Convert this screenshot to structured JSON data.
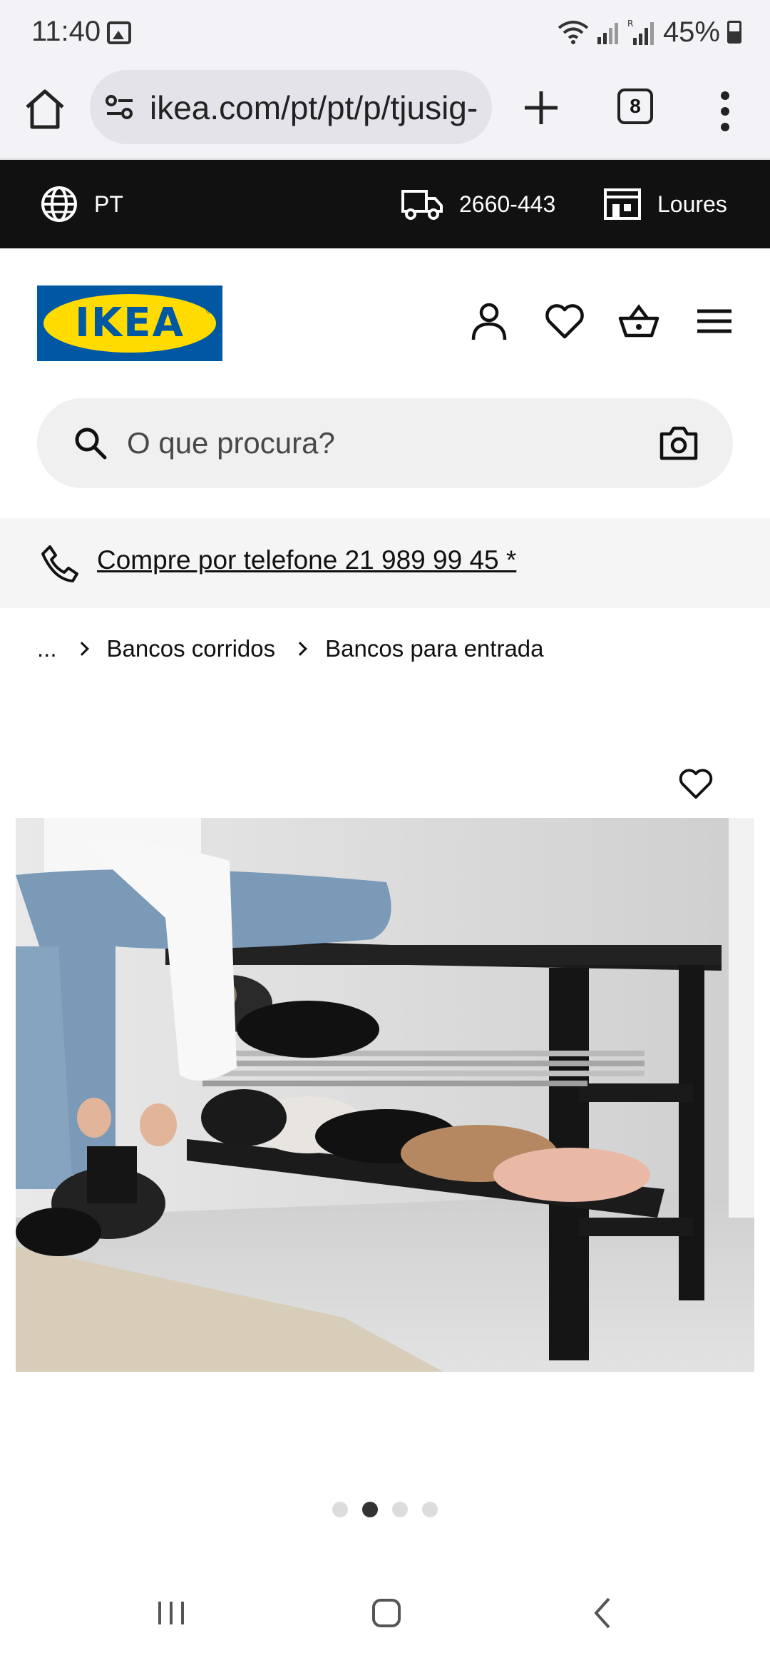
{
  "status_bar": {
    "time": "11:40",
    "battery": "45%"
  },
  "browser": {
    "url": "ikea.com/pt/pt/p/tjusig-",
    "tab_count": "8"
  },
  "top_strip": {
    "language": "PT",
    "postal_code": "2660-443",
    "store": "Loures"
  },
  "header": {
    "logo_text": "IKEA",
    "search_placeholder": "O que procura?"
  },
  "phone_banner": {
    "text": "Compre por telefone 21 989 99 45 *"
  },
  "breadcrumb": {
    "ellipsis": "...",
    "items": [
      "Bancos corridos",
      "Bancos para entrada"
    ]
  },
  "carousel": {
    "total": 4,
    "active_index": 1
  },
  "colors": {
    "ikea_blue": "#0058a3",
    "ikea_yellow": "#ffdb00",
    "strip_black": "#111111"
  }
}
